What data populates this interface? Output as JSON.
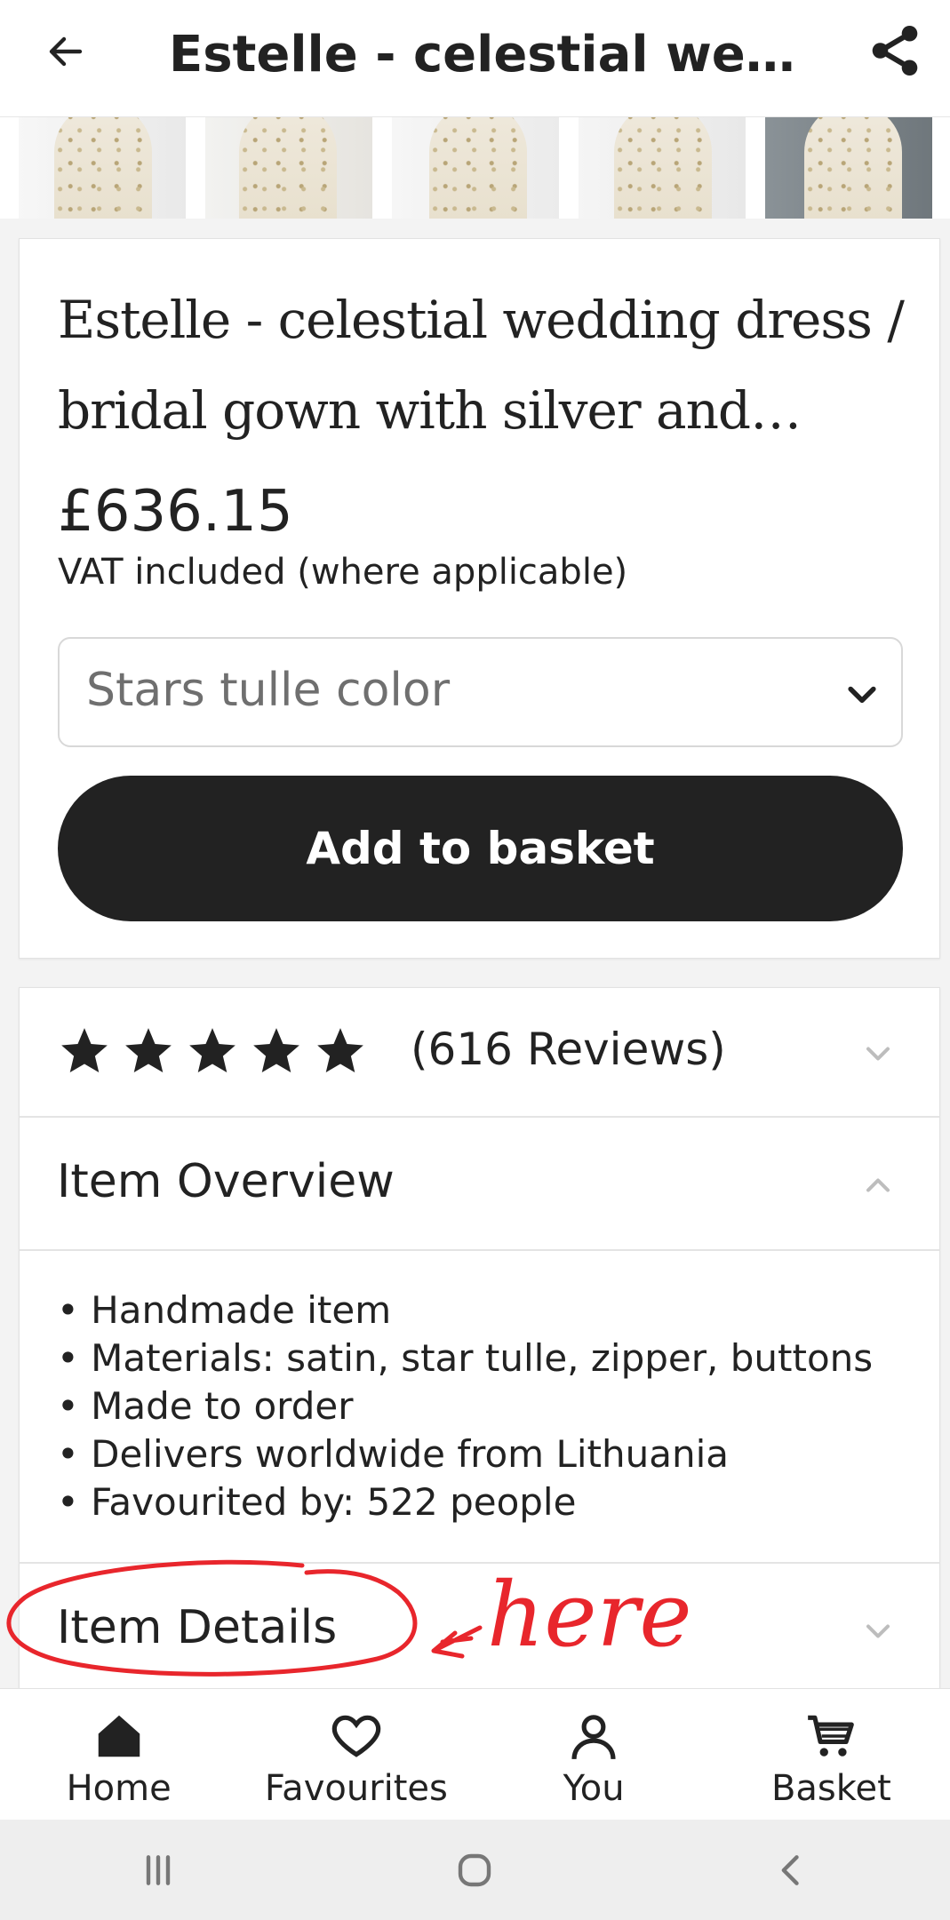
{
  "header": {
    "title": "Estelle - celestial wedd...",
    "back_icon": "arrow-left-icon",
    "share_icon": "share-icon"
  },
  "thumbnails": {
    "count": 5
  },
  "product": {
    "title": "Estelle - celestial wedding dress / bridal gown with silver and gold...",
    "price": "£636.15",
    "vat_note": "VAT included (where applicable)",
    "variation_select": {
      "placeholder": "Stars tulle color"
    },
    "add_to_basket_label": "Add to basket"
  },
  "reviews": {
    "rating": 5,
    "max_rating": 5,
    "label": "(616 Reviews)"
  },
  "item_overview": {
    "title": "Item Overview",
    "bullets": [
      "Handmade item",
      "Materials: satin, star tulle, zipper, buttons",
      "Made to order",
      "Delivers worldwide from Lithuania",
      "Favourited by: 522 people"
    ]
  },
  "item_details": {
    "title": "Item Details"
  },
  "annotation": {
    "text": "here",
    "color": "#e8262c"
  },
  "bottom_nav": {
    "items": [
      {
        "label": "Home",
        "icon": "home-icon"
      },
      {
        "label": "Favourites",
        "icon": "heart-icon"
      },
      {
        "label": "You",
        "icon": "user-icon"
      },
      {
        "label": "Basket",
        "icon": "cart-icon"
      }
    ]
  },
  "system_nav": {
    "icons": [
      "recents-icon",
      "home-button-icon",
      "back-nav-icon"
    ]
  },
  "colors": {
    "primary_button": "#222222",
    "background": "#f3f3f3",
    "card": "#ffffff"
  }
}
